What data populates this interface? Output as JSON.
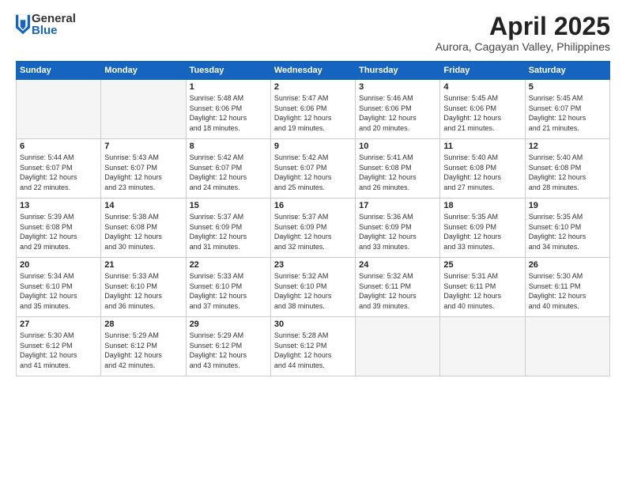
{
  "logo": {
    "general": "General",
    "blue": "Blue"
  },
  "title": "April 2025",
  "subtitle": "Aurora, Cagayan Valley, Philippines",
  "days_header": [
    "Sunday",
    "Monday",
    "Tuesday",
    "Wednesday",
    "Thursday",
    "Friday",
    "Saturday"
  ],
  "weeks": [
    [
      {
        "day": "",
        "info": ""
      },
      {
        "day": "",
        "info": ""
      },
      {
        "day": "1",
        "info": "Sunrise: 5:48 AM\nSunset: 6:06 PM\nDaylight: 12 hours\nand 18 minutes."
      },
      {
        "day": "2",
        "info": "Sunrise: 5:47 AM\nSunset: 6:06 PM\nDaylight: 12 hours\nand 19 minutes."
      },
      {
        "day": "3",
        "info": "Sunrise: 5:46 AM\nSunset: 6:06 PM\nDaylight: 12 hours\nand 20 minutes."
      },
      {
        "day": "4",
        "info": "Sunrise: 5:45 AM\nSunset: 6:06 PM\nDaylight: 12 hours\nand 21 minutes."
      },
      {
        "day": "5",
        "info": "Sunrise: 5:45 AM\nSunset: 6:07 PM\nDaylight: 12 hours\nand 21 minutes."
      }
    ],
    [
      {
        "day": "6",
        "info": "Sunrise: 5:44 AM\nSunset: 6:07 PM\nDaylight: 12 hours\nand 22 minutes."
      },
      {
        "day": "7",
        "info": "Sunrise: 5:43 AM\nSunset: 6:07 PM\nDaylight: 12 hours\nand 23 minutes."
      },
      {
        "day": "8",
        "info": "Sunrise: 5:42 AM\nSunset: 6:07 PM\nDaylight: 12 hours\nand 24 minutes."
      },
      {
        "day": "9",
        "info": "Sunrise: 5:42 AM\nSunset: 6:07 PM\nDaylight: 12 hours\nand 25 minutes."
      },
      {
        "day": "10",
        "info": "Sunrise: 5:41 AM\nSunset: 6:08 PM\nDaylight: 12 hours\nand 26 minutes."
      },
      {
        "day": "11",
        "info": "Sunrise: 5:40 AM\nSunset: 6:08 PM\nDaylight: 12 hours\nand 27 minutes."
      },
      {
        "day": "12",
        "info": "Sunrise: 5:40 AM\nSunset: 6:08 PM\nDaylight: 12 hours\nand 28 minutes."
      }
    ],
    [
      {
        "day": "13",
        "info": "Sunrise: 5:39 AM\nSunset: 6:08 PM\nDaylight: 12 hours\nand 29 minutes."
      },
      {
        "day": "14",
        "info": "Sunrise: 5:38 AM\nSunset: 6:08 PM\nDaylight: 12 hours\nand 30 minutes."
      },
      {
        "day": "15",
        "info": "Sunrise: 5:37 AM\nSunset: 6:09 PM\nDaylight: 12 hours\nand 31 minutes."
      },
      {
        "day": "16",
        "info": "Sunrise: 5:37 AM\nSunset: 6:09 PM\nDaylight: 12 hours\nand 32 minutes."
      },
      {
        "day": "17",
        "info": "Sunrise: 5:36 AM\nSunset: 6:09 PM\nDaylight: 12 hours\nand 33 minutes."
      },
      {
        "day": "18",
        "info": "Sunrise: 5:35 AM\nSunset: 6:09 PM\nDaylight: 12 hours\nand 33 minutes."
      },
      {
        "day": "19",
        "info": "Sunrise: 5:35 AM\nSunset: 6:10 PM\nDaylight: 12 hours\nand 34 minutes."
      }
    ],
    [
      {
        "day": "20",
        "info": "Sunrise: 5:34 AM\nSunset: 6:10 PM\nDaylight: 12 hours\nand 35 minutes."
      },
      {
        "day": "21",
        "info": "Sunrise: 5:33 AM\nSunset: 6:10 PM\nDaylight: 12 hours\nand 36 minutes."
      },
      {
        "day": "22",
        "info": "Sunrise: 5:33 AM\nSunset: 6:10 PM\nDaylight: 12 hours\nand 37 minutes."
      },
      {
        "day": "23",
        "info": "Sunrise: 5:32 AM\nSunset: 6:10 PM\nDaylight: 12 hours\nand 38 minutes."
      },
      {
        "day": "24",
        "info": "Sunrise: 5:32 AM\nSunset: 6:11 PM\nDaylight: 12 hours\nand 39 minutes."
      },
      {
        "day": "25",
        "info": "Sunrise: 5:31 AM\nSunset: 6:11 PM\nDaylight: 12 hours\nand 40 minutes."
      },
      {
        "day": "26",
        "info": "Sunrise: 5:30 AM\nSunset: 6:11 PM\nDaylight: 12 hours\nand 40 minutes."
      }
    ],
    [
      {
        "day": "27",
        "info": "Sunrise: 5:30 AM\nSunset: 6:12 PM\nDaylight: 12 hours\nand 41 minutes."
      },
      {
        "day": "28",
        "info": "Sunrise: 5:29 AM\nSunset: 6:12 PM\nDaylight: 12 hours\nand 42 minutes."
      },
      {
        "day": "29",
        "info": "Sunrise: 5:29 AM\nSunset: 6:12 PM\nDaylight: 12 hours\nand 43 minutes."
      },
      {
        "day": "30",
        "info": "Sunrise: 5:28 AM\nSunset: 6:12 PM\nDaylight: 12 hours\nand 44 minutes."
      },
      {
        "day": "",
        "info": ""
      },
      {
        "day": "",
        "info": ""
      },
      {
        "day": "",
        "info": ""
      }
    ]
  ]
}
